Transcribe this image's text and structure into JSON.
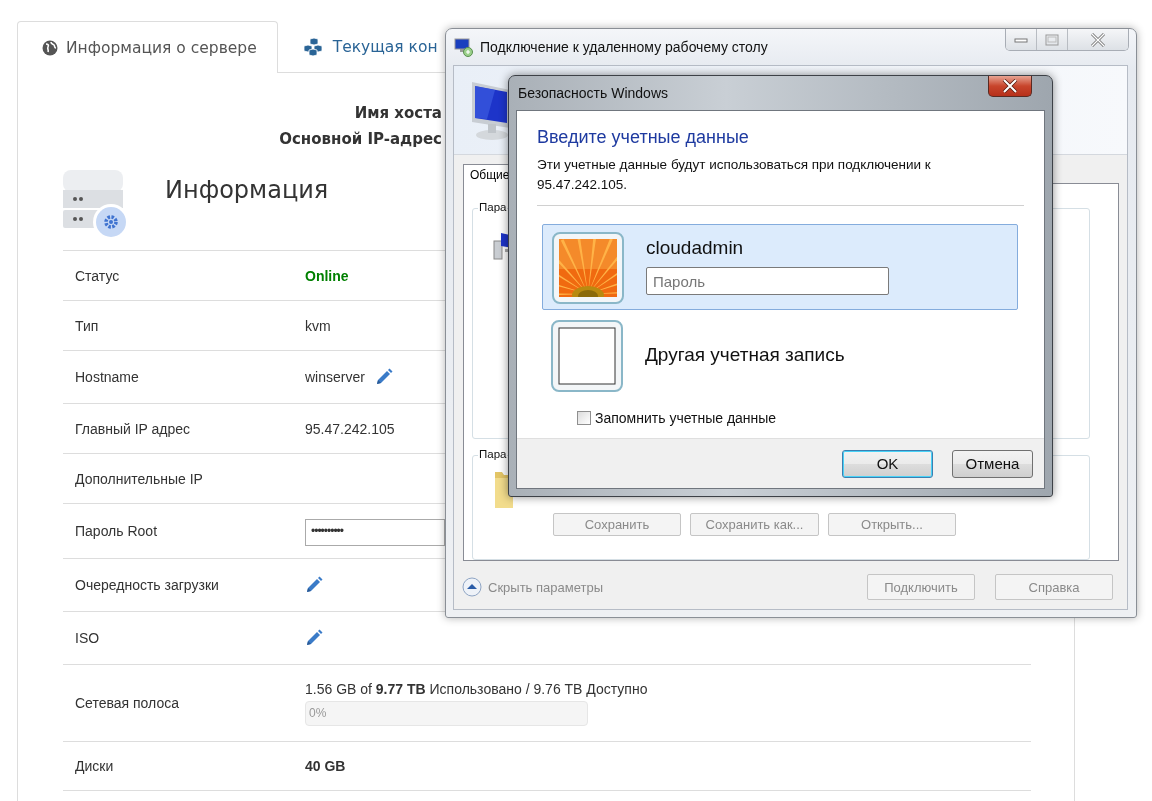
{
  "page": {
    "tabs": [
      {
        "label": "Информация о сервере",
        "selected": true
      },
      {
        "label": "Текущая кон",
        "selected": false
      }
    ],
    "summary": [
      "Имя хоста",
      "Основной IP-адрес"
    ],
    "section_title": "Информация",
    "rows": [
      {
        "kind": "status",
        "label": "Статус",
        "value": "Online"
      },
      {
        "kind": "text",
        "label": "Тип",
        "value": "kvm"
      },
      {
        "kind": "editable",
        "label": "Hostname",
        "value": "winserver"
      },
      {
        "kind": "text",
        "label": "Главный IP адрес",
        "value": "95.47.242.105"
      },
      {
        "kind": "text",
        "label": "Дополнительные IP"
      },
      {
        "kind": "password",
        "label": "Пароль Root",
        "value": "••••••••••"
      },
      {
        "kind": "edit",
        "label": "Очередность загрузки"
      },
      {
        "kind": "edit",
        "label": "ISO"
      },
      {
        "kind": "usage",
        "label": "Сетевая полоса",
        "value": "1.56 GB of **9.77 TB** Использовано / 9.76 TB Доступно",
        "level": 0,
        "reading": "0%"
      },
      {
        "kind": "bold",
        "label": "Диски",
        "value": "40 GB"
      }
    ]
  },
  "rdp_window": {
    "title": "Подключение к удаленному рабочему столу",
    "tab": "Общие",
    "groups": [
      "Пара",
      "Пара"
    ],
    "file_buttons": [
      {
        "label": "Сохранить",
        "disabled": true
      },
      {
        "label": "Сохранить как...",
        "disabled": true
      },
      {
        "label": "Открыть...",
        "disabled": true
      }
    ],
    "toggle": {
      "label": "Скрыть параметры",
      "disabled": true
    },
    "buttons": [
      {
        "label": "Подключить",
        "disabled": true
      },
      {
        "label": "Справка",
        "disabled": true
      }
    ]
  },
  "security_dialog": {
    "title": "Безопасность Windows",
    "heading": "Введите учетные данные",
    "description": "Эти учетные данные будут использоваться при подключении к 95.47.242.105.",
    "accounts": [
      {
        "kind": "user",
        "name": "cloudadmin",
        "selected": true,
        "password_placeholder": "Пароль"
      },
      {
        "kind": "other",
        "name": "Другая учетная запись",
        "selected": false
      }
    ],
    "remember": {
      "label": "Запомнить учетные данные",
      "checked": false
    },
    "buttons": [
      {
        "label": "OK",
        "default": true
      },
      {
        "label": "Отмена",
        "default": false
      }
    ]
  }
}
